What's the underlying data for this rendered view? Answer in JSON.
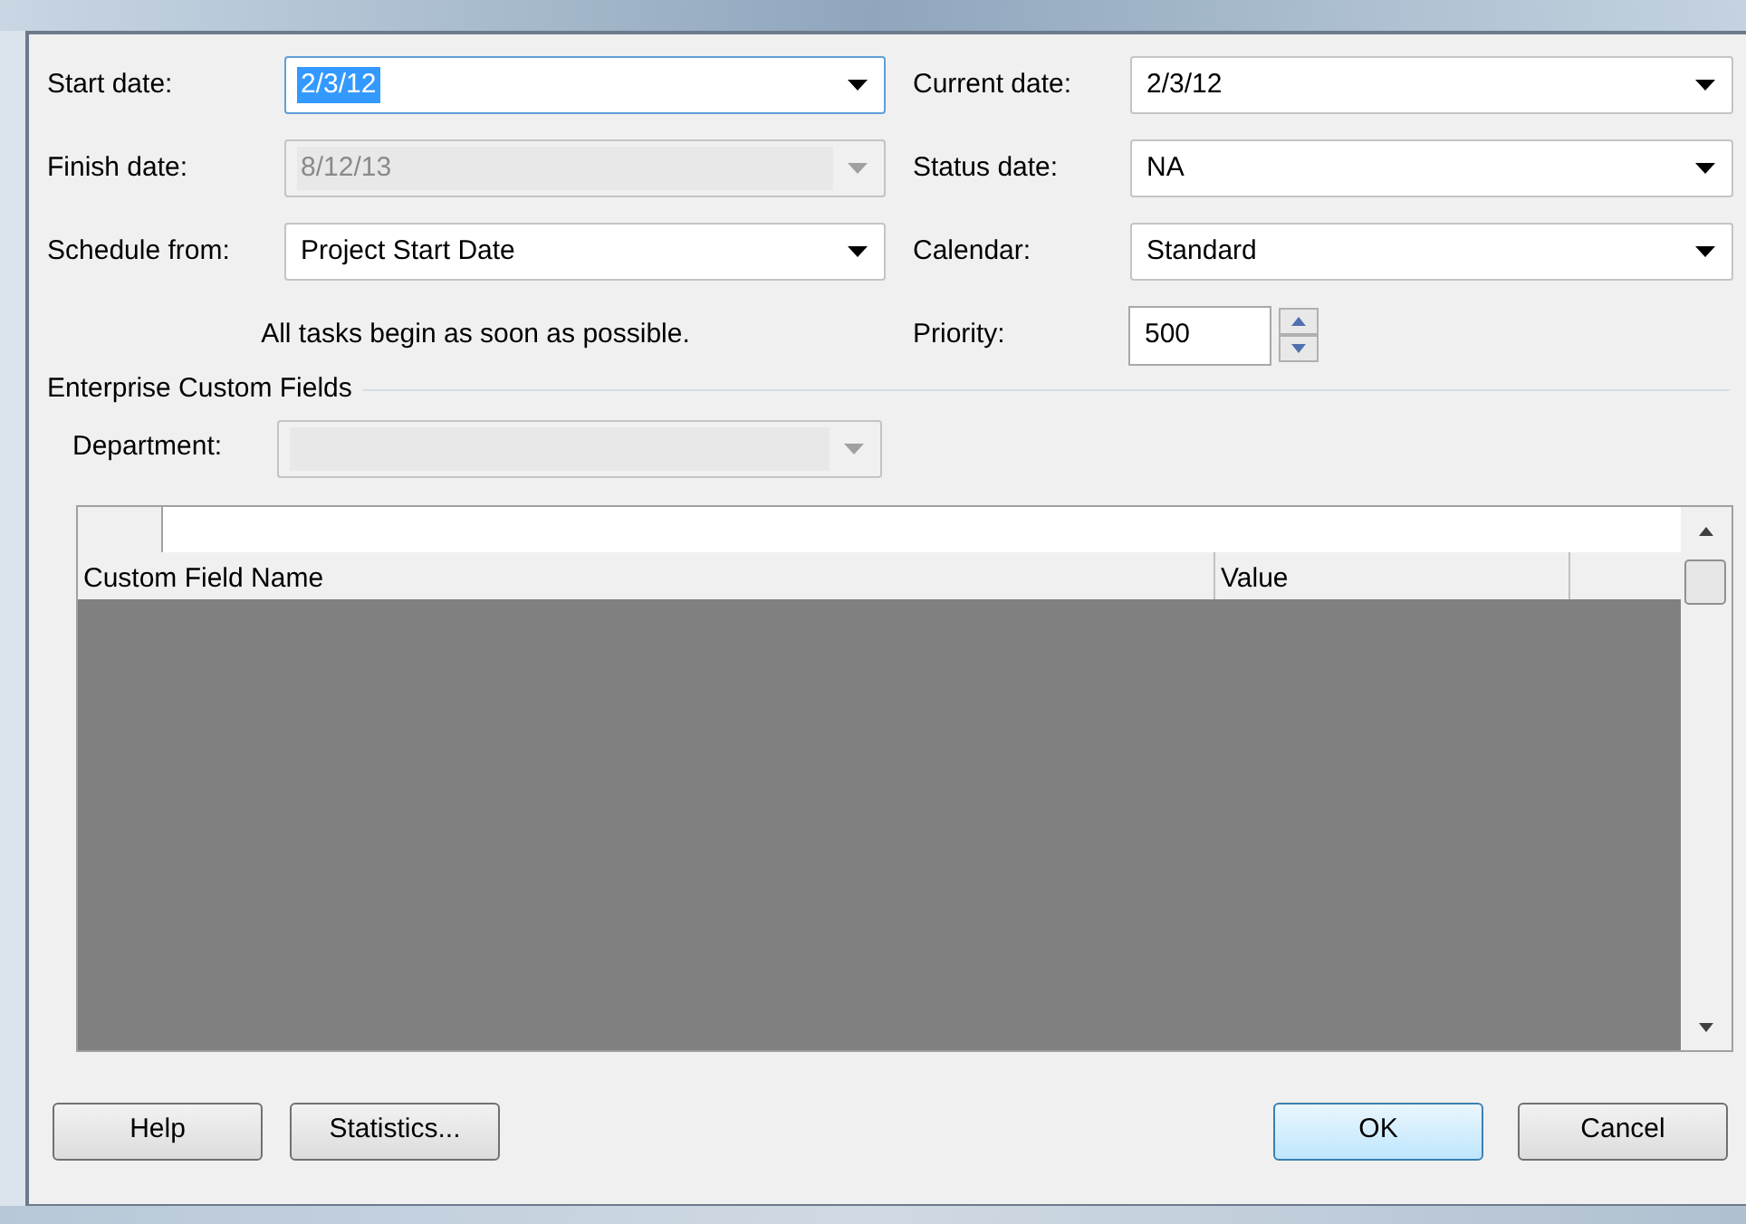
{
  "left_fields": [
    {
      "label": "Start date:",
      "value": "2/3/12",
      "disabled": false,
      "focused": true
    },
    {
      "label": "Finish date:",
      "value": "8/12/13",
      "disabled": true,
      "focused": false
    },
    {
      "label": "Schedule from:",
      "value": "Project Start Date",
      "disabled": false,
      "focused": false
    }
  ],
  "right_fields": [
    {
      "label": "Current date:",
      "value": "2/3/12",
      "disabled": false,
      "focused": false
    },
    {
      "label": "Status date:",
      "value": "NA",
      "disabled": false,
      "focused": false
    },
    {
      "label": "Calendar:",
      "value": "Standard",
      "disabled": false,
      "focused": false
    }
  ],
  "note": "All tasks begin as soon as possible.",
  "priority": {
    "label": "Priority:",
    "value": "500"
  },
  "enterprise": {
    "title": "Enterprise Custom Fields",
    "department": {
      "label": "Department:",
      "disabled": true,
      "focused": false
    }
  },
  "table": {
    "columns": [
      "Custom Field Name",
      "Value"
    ]
  },
  "left_buttons": [
    {
      "label": "Help",
      "default": false
    },
    {
      "label": "Statistics...",
      "default": false
    }
  ],
  "right_buttons": [
    {
      "label": "OK",
      "default": true
    },
    {
      "label": "Cancel",
      "default": false
    }
  ]
}
